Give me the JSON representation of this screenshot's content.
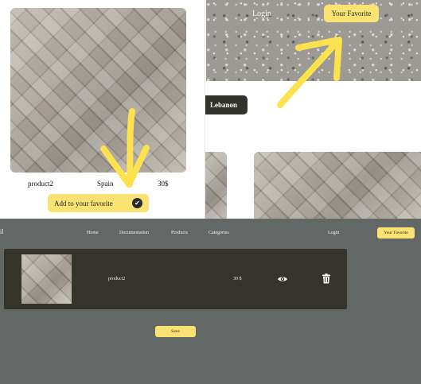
{
  "product_card": {
    "name": "product2",
    "country": "Spain",
    "price": "30$",
    "add_button_label": "Add to your favorite",
    "check_icon": "check-circle-icon"
  },
  "hero": {
    "login_label": "Login",
    "favorite_button_label": "Your Favorite",
    "country_tag": "Lebanon"
  },
  "favorites_page": {
    "nav_cut_text": "il",
    "nav": {
      "home": "Home",
      "documentation": "Documentation",
      "products": "Products",
      "categories": "Categories",
      "login": "Login",
      "favorite_button": "Your Favorite"
    },
    "items": [
      {
        "name": "product2",
        "price": "30 $",
        "view_icon": "eye-icon",
        "delete_icon": "trash-icon"
      }
    ],
    "save_label": "Save"
  },
  "colors": {
    "accent_yellow": "#fbe373",
    "dark_panel": "#34332c",
    "page_gray": "#636766",
    "arrow_yellow": "#fde24f"
  }
}
